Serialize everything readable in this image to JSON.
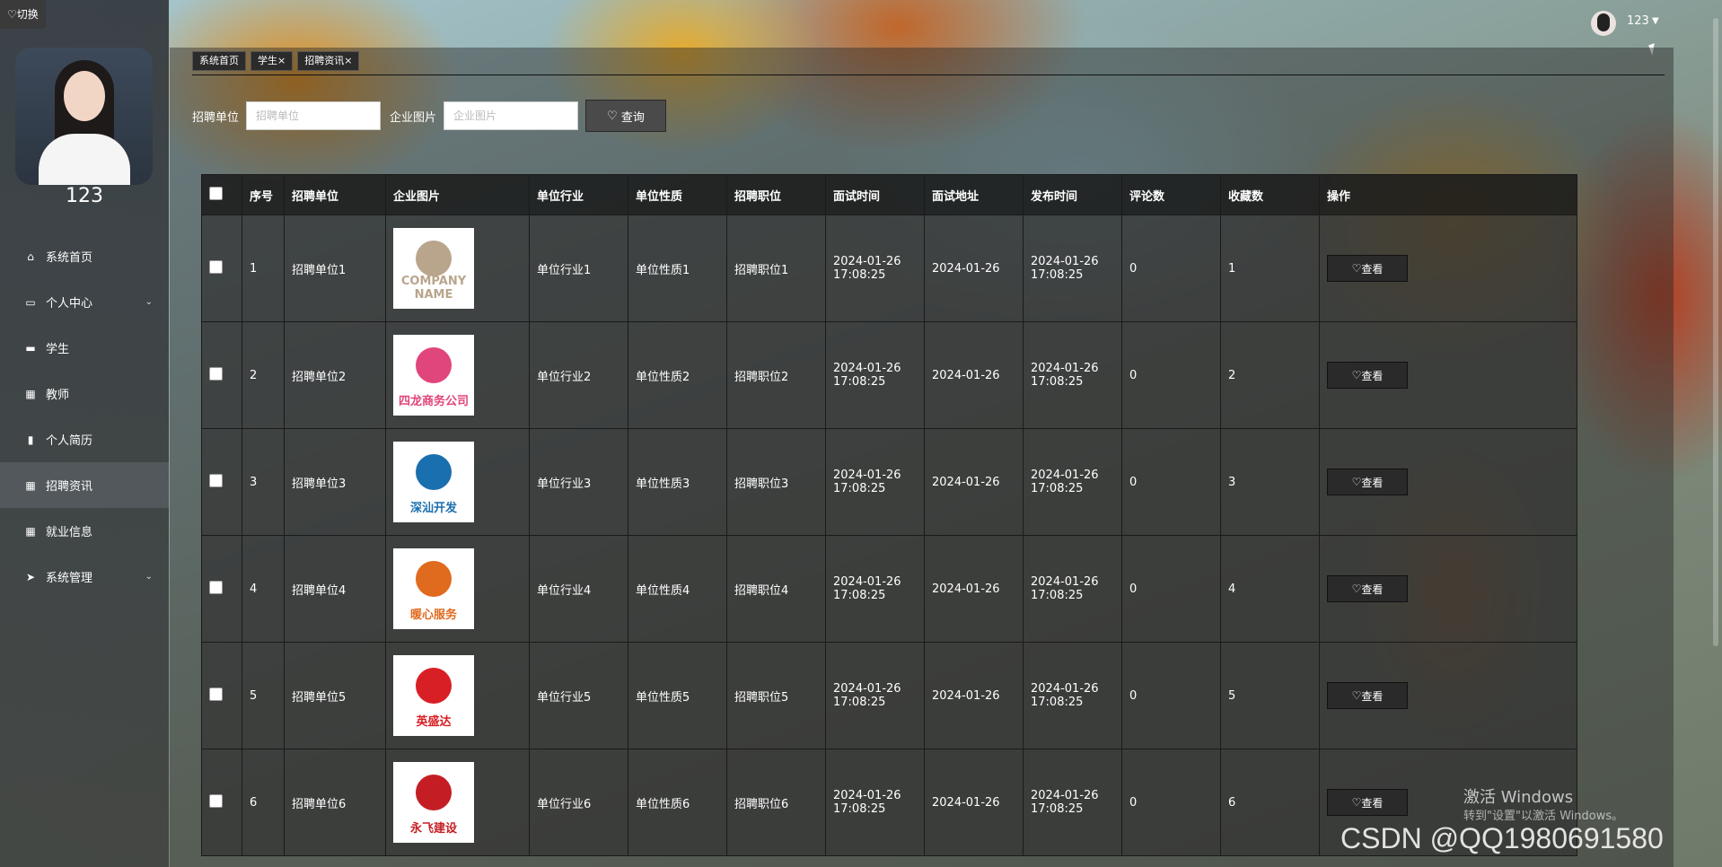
{
  "sidebar": {
    "switch_label": "切换",
    "username": "123",
    "items": [
      {
        "label": "系统首页",
        "icon": "home-icon",
        "active": false,
        "expandable": false
      },
      {
        "label": "个人中心",
        "icon": "card-icon",
        "active": false,
        "expandable": true
      },
      {
        "label": "学生",
        "icon": "monitor-icon",
        "active": false,
        "expandable": false
      },
      {
        "label": "教师",
        "icon": "grid-icon",
        "active": false,
        "expandable": false
      },
      {
        "label": "个人简历",
        "icon": "clipboard-icon",
        "active": false,
        "expandable": false
      },
      {
        "label": "招聘资讯",
        "icon": "grid-icon",
        "active": true,
        "expandable": false
      },
      {
        "label": "就业信息",
        "icon": "grid-icon",
        "active": false,
        "expandable": false
      },
      {
        "label": "系统管理",
        "icon": "send-icon",
        "active": false,
        "expandable": true
      }
    ]
  },
  "header": {
    "user": "123"
  },
  "tabs": [
    "系统首页",
    "学生",
    "招聘资讯"
  ],
  "tab_close": [
    "",
    "×",
    "×"
  ],
  "search": {
    "unit_label": "招聘单位",
    "unit_placeholder": "招聘单位",
    "image_label": "企业图片",
    "image_placeholder": "企业图片",
    "query_label": "查询"
  },
  "table": {
    "columns": [
      "序号",
      "招聘单位",
      "企业图片",
      "单位行业",
      "单位性质",
      "招聘职位",
      "面试时间",
      "面试地址",
      "发布时间",
      "评论数",
      "收藏数",
      "操作"
    ],
    "rows": [
      {
        "no": "1",
        "unit": "招聘单位1",
        "industry": "单位行业1",
        "nature": "单位性质1",
        "position": "招聘职位1",
        "interview_time": "2024-01-26 17:08:25",
        "address": "2024-01-26",
        "publish_time": "2024-01-26 17:08:25",
        "comments": "0",
        "favorites": "1",
        "logo_text": "COMPANY NAME",
        "logo_color": "#b9a58c"
      },
      {
        "no": "2",
        "unit": "招聘单位2",
        "industry": "单位行业2",
        "nature": "单位性质2",
        "position": "招聘职位2",
        "interview_time": "2024-01-26 17:08:25",
        "address": "2024-01-26",
        "publish_time": "2024-01-26 17:08:25",
        "comments": "0",
        "favorites": "2",
        "logo_text": "四龙商务公司",
        "logo_color": "#e0457b"
      },
      {
        "no": "3",
        "unit": "招聘单位3",
        "industry": "单位行业3",
        "nature": "单位性质3",
        "position": "招聘职位3",
        "interview_time": "2024-01-26 17:08:25",
        "address": "2024-01-26",
        "publish_time": "2024-01-26 17:08:25",
        "comments": "0",
        "favorites": "3",
        "logo_text": "深汕开发",
        "logo_color": "#1a6fae"
      },
      {
        "no": "4",
        "unit": "招聘单位4",
        "industry": "单位行业4",
        "nature": "单位性质4",
        "position": "招聘职位4",
        "interview_time": "2024-01-26 17:08:25",
        "address": "2024-01-26",
        "publish_time": "2024-01-26 17:08:25",
        "comments": "0",
        "favorites": "4",
        "logo_text": "暖心服务",
        "logo_color": "#e06a1e"
      },
      {
        "no": "5",
        "unit": "招聘单位5",
        "industry": "单位行业5",
        "nature": "单位性质5",
        "position": "招聘职位5",
        "interview_time": "2024-01-26 17:08:25",
        "address": "2024-01-26",
        "publish_time": "2024-01-26 17:08:25",
        "comments": "0",
        "favorites": "5",
        "logo_text": "英盛达",
        "logo_color": "#d91f26"
      },
      {
        "no": "6",
        "unit": "招聘单位6",
        "industry": "单位行业6",
        "nature": "单位性质6",
        "position": "招聘职位6",
        "interview_time": "2024-01-26 17:08:25",
        "address": "2024-01-26",
        "publish_time": "2024-01-26 17:08:25",
        "comments": "0",
        "favorites": "6",
        "logo_text": "永飞建设",
        "logo_color": "#c41e24"
      }
    ],
    "view_label": "查看"
  },
  "overlay": {
    "watermark": "CSDN @QQ1980691580",
    "activate_title": "激活 Windows",
    "activate_sub": "转到\"设置\"以激活 Windows。"
  }
}
